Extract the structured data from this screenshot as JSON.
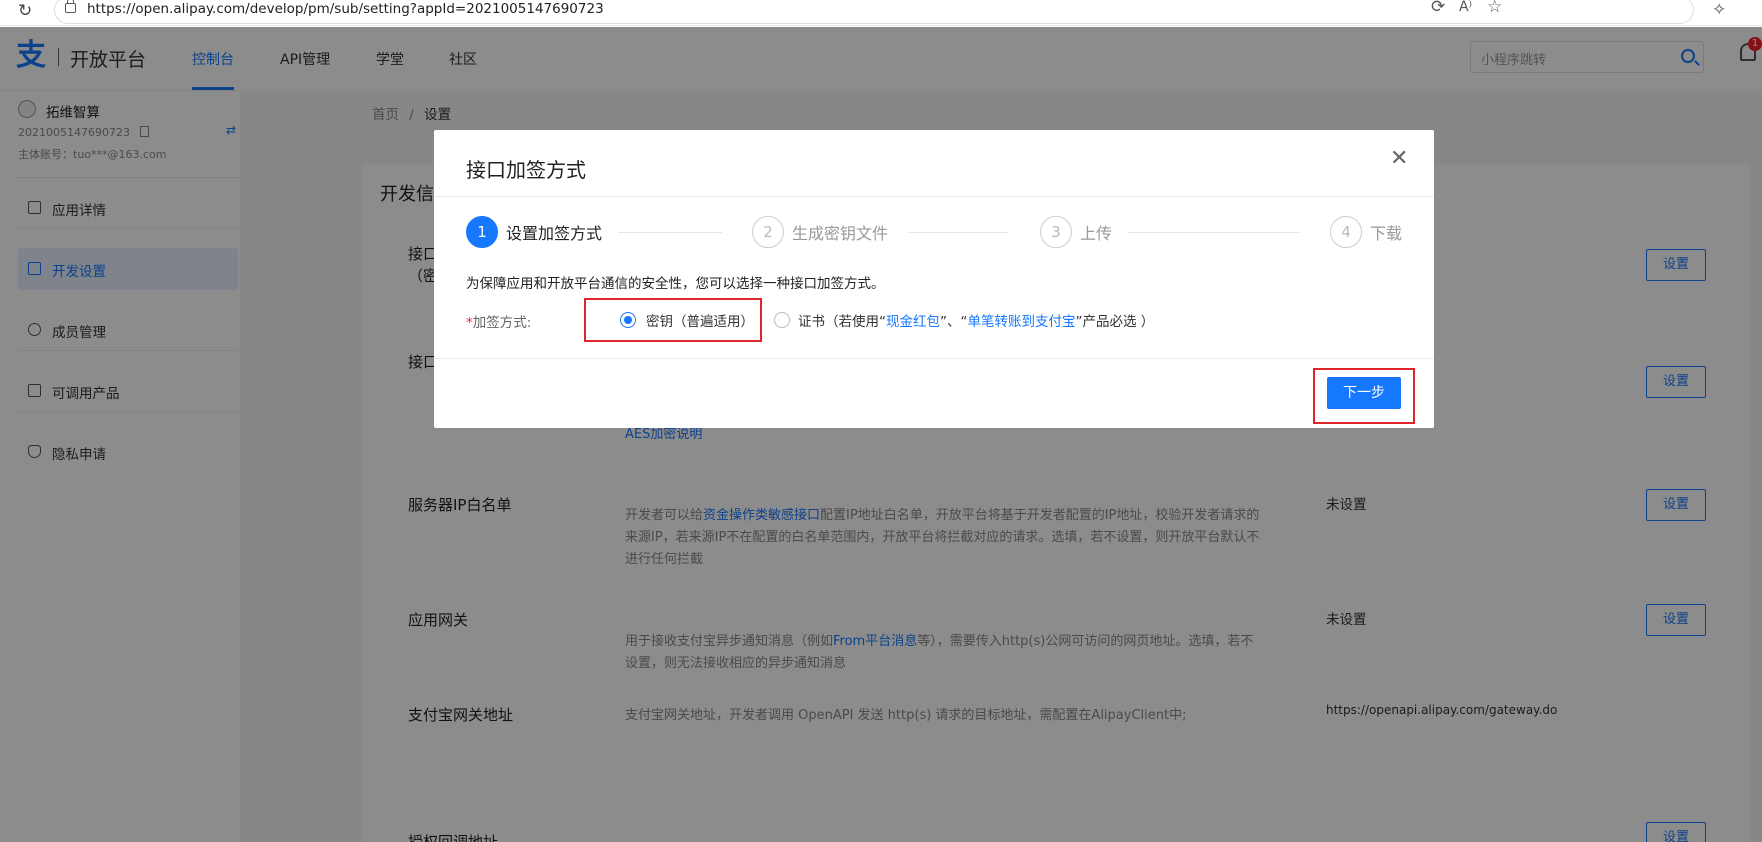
{
  "browser": {
    "url": "https://open.alipay.com/develop/pm/sub/setting?appId=2021005147690723",
    "refresh_icon": "refresh-icon",
    "lock_icon": "lock-icon"
  },
  "topnav": {
    "logo_mark": "支",
    "logo_text": "开放平台",
    "items": [
      {
        "label": "控制台",
        "active": true
      },
      {
        "label": "API管理",
        "active": false
      },
      {
        "label": "学堂",
        "active": false
      },
      {
        "label": "社区",
        "active": false
      }
    ],
    "search_placeholder": "小程序跳转",
    "notification_count": "1",
    "accent": "#1677ff"
  },
  "sidebar": {
    "app_name": "拓维智算",
    "app_id": "2021005147690723",
    "account": "主体账号：tuo***@163.com",
    "items": [
      {
        "label": "应用详情",
        "active": false
      },
      {
        "label": "开发设置",
        "active": true
      },
      {
        "label": "成员管理",
        "active": false
      },
      {
        "label": "可调用产品",
        "active": false
      },
      {
        "label": "隐私申请",
        "active": false
      }
    ]
  },
  "breadcrumb": {
    "home": "首页",
    "sep": "/",
    "current": "设置"
  },
  "main": {
    "card_title": "开发信",
    "rows": [
      {
        "title": "接口",
        "sub": "（密",
        "desc_pre": "",
        "desc_link": "",
        "desc_post": "",
        "status": "",
        "button": "设置"
      },
      {
        "title": "接口",
        "sub": "",
        "desc_pre": "",
        "desc_link": "AES加密说明",
        "desc_post": "",
        "status": "",
        "button": "设置"
      },
      {
        "title": "服务器IP白名单",
        "sub": "",
        "desc_pre": "开发者可以给",
        "desc_link": "资金操作类敏感接口",
        "desc_post": "配置IP地址白名单，开放平台将基于开发者配置的IP地址，校验开发者请求的来源IP，若来源IP不在配置的白名单范围内，开放平台将拦截对应的请求。选填，若不设置，则开放平台默认不进行任何拦截",
        "status": "未设置",
        "button": "设置"
      },
      {
        "title": "应用网关",
        "sub": "",
        "desc_pre": "用于接收支付宝异步通知消息（例如",
        "desc_link": "From平台消息",
        "desc_post": "等），需要传入http(s)公网可访问的网页地址。选填，若不设置，则无法接收相应的异步通知消息",
        "status": "未设置",
        "button": "设置"
      },
      {
        "title": "支付宝网关地址",
        "sub": "",
        "desc_pre": "支付宝网关地址，开发者调用 OpenAPI 发送 http(s) 请求的目标地址，需配置在AlipayClient中;",
        "desc_link": "",
        "desc_post": "",
        "status": "https://openapi.alipay.com/gateway.do",
        "button": ""
      },
      {
        "title": "授权回调地址",
        "sub": "",
        "desc_pre": "",
        "desc_link": "",
        "desc_post": "",
        "status": "",
        "button": "设置"
      }
    ]
  },
  "modal": {
    "title": "接口加签方式",
    "close_icon": "close-icon",
    "steps": [
      {
        "num": "1",
        "label": "设置加签方式",
        "active": true
      },
      {
        "num": "2",
        "label": "生成密钥文件",
        "active": false
      },
      {
        "num": "3",
        "label": "上传",
        "active": false
      },
      {
        "num": "4",
        "label": "下载",
        "active": false
      }
    ],
    "description": "为保障应用和开放平台通信的安全性，您可以选择一种接口加签方式。",
    "field_required": "*",
    "field_label": "加签方式:",
    "options": {
      "key": {
        "label": "密钥（普遍适用）",
        "checked": true
      },
      "cert": {
        "checked": false,
        "pre": "证书（若使用“",
        "link1": "现金红包",
        "mid": "”、“",
        "link2": "单笔转账到支付宝",
        "post": "”产品必选 ）"
      }
    },
    "next_button": "下一步",
    "highlight_color": "#e0242c"
  }
}
